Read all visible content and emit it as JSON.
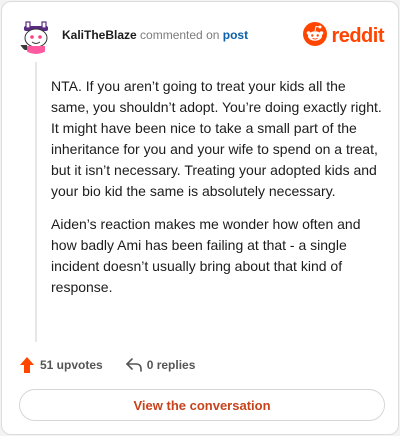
{
  "header": {
    "username": "KaliTheBlaze",
    "action_text": " commented on ",
    "post_link": "post",
    "logo_text": "reddit"
  },
  "comment": {
    "paragraphs": [
      "NTA. If you aren’t going to treat your kids all the same, you shouldn’t adopt. You’re doing exactly right. It might have been nice to take a small part of the inheritance for you and your wife to spend on a treat, but it isn’t necessary. Treating your adopted kids and your bio kid the same is absolutely necessary.",
      "Aiden’s reaction makes me wonder how often and how badly Ami has been failing at that - a single incident doesn’t usually bring about that kind of response."
    ]
  },
  "actions": {
    "upvotes": "51 upvotes",
    "replies": "0 replies"
  },
  "footer": {
    "view_button": "View the conversation"
  },
  "colors": {
    "brand": "#ff4500",
    "upvote": "#ff4500",
    "link": "#0a5fa8",
    "button_text": "#c7431c"
  },
  "icons": {
    "logo": "reddit-snoo-icon",
    "upvote": "upvote-arrow-icon",
    "reply": "reply-arrow-icon",
    "avatar": "snoo-avatar"
  }
}
